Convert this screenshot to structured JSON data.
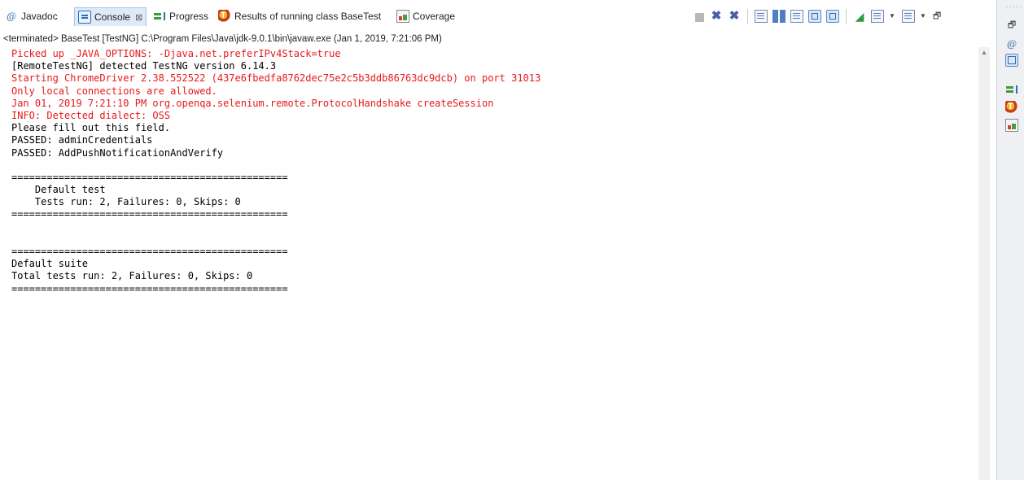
{
  "tabs": [
    {
      "label": "Javadoc",
      "icon": "javadoc-icon",
      "active": false
    },
    {
      "label": "Console",
      "icon": "console-icon",
      "active": true,
      "close": "⊠"
    },
    {
      "label": "Progress",
      "icon": "progress-icon",
      "active": false
    },
    {
      "label": "Results of running class BaseTest",
      "icon": "testng-icon",
      "active": false
    },
    {
      "label": "Coverage",
      "icon": "coverage-icon",
      "active": false
    }
  ],
  "toolbar": {
    "icons": [
      "terminate-icon",
      "remove-launch-icon",
      "remove-all-terminated-icon",
      "clear-console-icon",
      "scroll-lock-icon",
      "word-wrap-icon",
      "show-on-stdout-icon",
      "show-on-stderr-icon",
      "pin-console-icon",
      "display-selected-console-icon",
      "open-console-icon",
      "minimize-icon"
    ]
  },
  "header": "<terminated> BaseTest [TestNG] C:\\Program Files\\Java\\jdk-9.0.1\\bin\\javaw.exe (Jan 1, 2019, 7:21:06 PM)",
  "console": {
    "lines": [
      {
        "text": "Picked up _JAVA_OPTIONS: -Djava.net.preferIPv4Stack=true",
        "stream": "err"
      },
      {
        "text": "[RemoteTestNG] detected TestNG version 6.14.3",
        "stream": "out"
      },
      {
        "text": "Starting ChromeDriver 2.38.552522 (437e6fbedfa8762dec75e2c5b3ddb86763dc9dcb) on port 31013",
        "stream": "err"
      },
      {
        "text": "Only local connections are allowed.",
        "stream": "err"
      },
      {
        "text": "Jan 01, 2019 7:21:10 PM org.openqa.selenium.remote.ProtocolHandshake createSession",
        "stream": "err"
      },
      {
        "text": "INFO: Detected dialect: OSS",
        "stream": "err"
      },
      {
        "text": "Please fill out this field.",
        "stream": "out"
      },
      {
        "text": "PASSED: adminCredentials",
        "stream": "out"
      },
      {
        "text": "PASSED: AddPushNotificationAndVerify",
        "stream": "out"
      },
      {
        "text": "",
        "stream": "out"
      },
      {
        "text": "===============================================",
        "stream": "out"
      },
      {
        "text": "    Default test",
        "stream": "out"
      },
      {
        "text": "    Tests run: 2, Failures: 0, Skips: 0",
        "stream": "out"
      },
      {
        "text": "===============================================",
        "stream": "out"
      },
      {
        "text": "",
        "stream": "out"
      },
      {
        "text": "",
        "stream": "out"
      },
      {
        "text": "===============================================",
        "stream": "out"
      },
      {
        "text": "Default suite",
        "stream": "out"
      },
      {
        "text": "Total tests run: 2, Failures: 0, Skips: 0",
        "stream": "out"
      },
      {
        "text": "===============================================",
        "stream": "out"
      }
    ]
  },
  "side_trim": {
    "icons": [
      "restore-icon",
      "javadoc-icon",
      "console-icon",
      "progress-icon",
      "testng-icon",
      "coverage-icon"
    ]
  },
  "colors": {
    "stderr": "#e8181a",
    "stdout": "#000000",
    "active_tab": "#dfeaf8"
  }
}
